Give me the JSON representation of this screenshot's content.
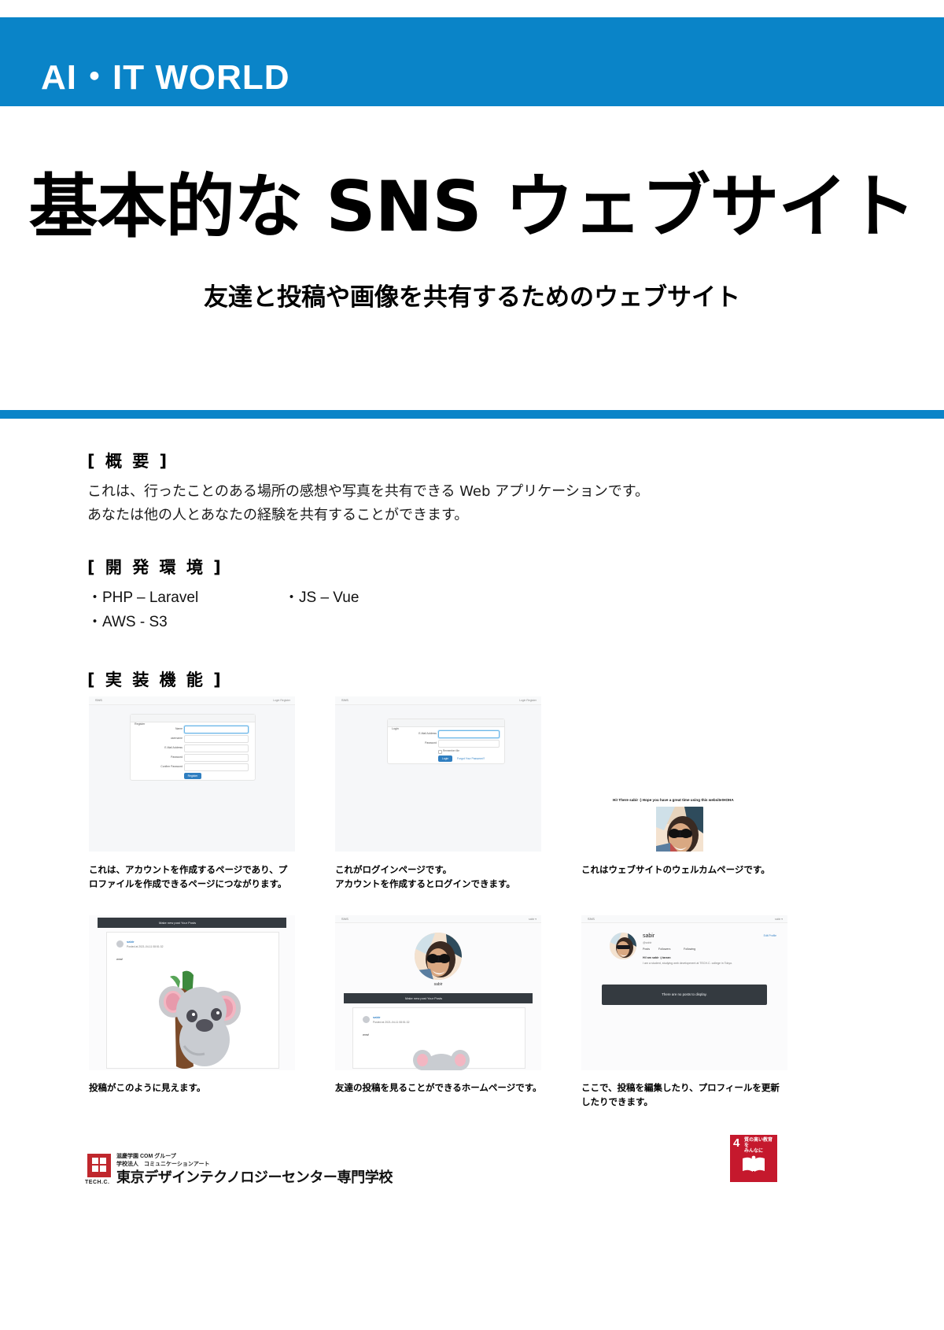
{
  "brand": {
    "banner_title": "AI・IT WORLD",
    "banner_color": "#0a84c8"
  },
  "hero": {
    "title": "基本的な SNS ウェブサイト",
    "subtitle": "友達と投稿や画像を共有するためのウェブサイト"
  },
  "sections": {
    "overview": {
      "heading": "[ 概 要 ]",
      "line1": "これは、行ったことのある場所の感想や写真を共有できる Web アプリケーションです。",
      "line2": "あなたは他の人とあなたの経験を共有することができます。"
    },
    "environment": {
      "heading": "[ 開 発 環 境 ]",
      "col1": [
        "・PHP – Laravel",
        "・AWS - S3"
      ],
      "col2": [
        "・JS – Vue"
      ]
    },
    "features": {
      "heading": "[ 実 装 機 能 ]"
    }
  },
  "features": [
    {
      "id": "register",
      "caption": "これは、アカウントを作成するページであり、プロファイルを作成できるページにつながります。",
      "mock": {
        "brand": "SNS",
        "nav_right": "Login   Register",
        "card_title": "Register",
        "fields": [
          "Name",
          "username",
          "E-Mail Address",
          "Password",
          "Confirm Password"
        ],
        "submit": "Register"
      }
    },
    {
      "id": "login",
      "caption": "これがログインページです。\nアカウントを作成するとログインできます。",
      "mock": {
        "brand": "SNS",
        "nav_right": "Login   Register",
        "card_title": "Login",
        "fields": [
          "E-Mail Address",
          "Password"
        ],
        "remember_label": "Remember Me",
        "submit": "Login",
        "forgot_link": "Forgot Your Password?"
      }
    },
    {
      "id": "welcome",
      "caption": "これはウェブサイトのウェルカムページです。",
      "mock": {
        "message": "Hi! There sabir :) Hope you have a great time using this website!HOHA",
        "username": "sabir"
      }
    },
    {
      "id": "post-view",
      "caption": "投稿がこのように見えます。",
      "mock": {
        "nav_left": "",
        "nav_center": "Make new post    Your Posts",
        "username": "sabir",
        "meta": "Posted at 2021-04-11 08:51:32",
        "body": "wow!"
      }
    },
    {
      "id": "home",
      "caption": "友達の投稿を見ることができるホームページです。",
      "mock": {
        "brand": "SNS",
        "nav_right": "sabir  ▾",
        "profile_name": "sabir",
        "nav_center": "Make new post    Your Posts",
        "post_username": "sabir",
        "post_meta": "Posted at 2021-04-11 08:51:32",
        "post_body": "wow!"
      }
    },
    {
      "id": "profile",
      "caption": "ここで、投稿を編集したり、プロフィールを更新したりできます。",
      "mock": {
        "brand": "SNS",
        "nav_right": "sabir ▾",
        "name": "sabir",
        "handle": "@sabir",
        "tabs": [
          "Posts",
          "Followers",
          "Following"
        ],
        "bio_title": "Hi! am sabir :) tarzan",
        "bio_text": "I am a student, studying web development at TECH.C. college in Tokyo.",
        "edit_link": "Edit Profile",
        "empty_state": "There are no posts to display."
      }
    }
  ],
  "footer": {
    "school_line1": "滋慶学園 COM グループ",
    "school_line2": "学校法人　コミュニケーションアート",
    "logo_text": "TECH.C.",
    "school_name": "東京デザインテクノロジーセンター専門学校",
    "sdg": {
      "number": "4",
      "label": "質の高い教育を\nみんなに",
      "color": "#c5192d"
    }
  }
}
